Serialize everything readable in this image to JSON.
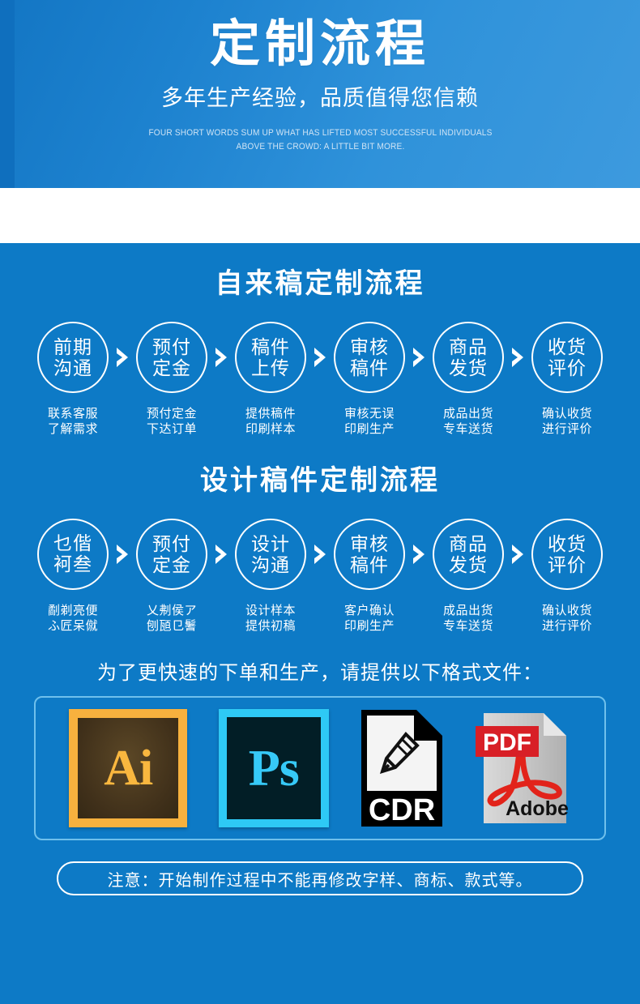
{
  "banner": {
    "title": "定制流程",
    "subtitle": "多年生产经验，品质值得您信赖",
    "eyebrow_line1": "FOUR SHORT WORDS SUM UP WHAT HAS LIFTED MOST SUCCESSFUL INDIVIDUALS",
    "eyebrow_line2": "ABOVE THE CROWD: A LITTLE BIT MORE."
  },
  "section1": {
    "heading": "自来稿定制流程",
    "steps": [
      {
        "circle_line1": "前期",
        "circle_line2": "沟通",
        "caption_line1": "联系客服",
        "caption_line2": "了解需求"
      },
      {
        "circle_line1": "预付",
        "circle_line2": "定金",
        "caption_line1": "预付定金",
        "caption_line2": "下达订单"
      },
      {
        "circle_line1": "稿件",
        "circle_line2": "上传",
        "caption_line1": "提供稿件",
        "caption_line2": "印刷样本"
      },
      {
        "circle_line1": "审核",
        "circle_line2": "稿件",
        "caption_line1": "审核无误",
        "caption_line2": "印刷生产"
      },
      {
        "circle_line1": "商品",
        "circle_line2": "发货",
        "caption_line1": "成品出货",
        "caption_line2": "专车送货"
      },
      {
        "circle_line1": "收货",
        "circle_line2": "评价",
        "caption_line1": "确认收货",
        "caption_line2": "进行评价"
      }
    ]
  },
  "section2": {
    "heading": "设计稿件定制流程",
    "steps": [
      {
        "circle_line1": "乜偕",
        "circle_line2": "袔叁",
        "caption_line1": "劀剃亮便",
        "caption_line2": "ふ匠呆僦"
      },
      {
        "circle_line1": "预付",
        "circle_line2": "定金",
        "caption_line1": "乂刜侯ア",
        "caption_line2": "刨瓸㔾鬐"
      },
      {
        "circle_line1": "设计",
        "circle_line2": "沟通",
        "caption_line1": "设计样本",
        "caption_line2": "提供初稿"
      },
      {
        "circle_line1": "审核",
        "circle_line2": "稿件",
        "caption_line1": "客户确认",
        "caption_line2": "印刷生产"
      },
      {
        "circle_line1": "商品",
        "circle_line2": "发货",
        "caption_line1": "成品出货",
        "caption_line2": "专车送货"
      },
      {
        "circle_line1": "收货",
        "circle_line2": "评价",
        "caption_line1": "确认收货",
        "caption_line2": "进行评价"
      }
    ]
  },
  "formats": {
    "title": "为了更快速的下单和生产，请提供以下格式文件：",
    "items": [
      {
        "name": "illustrator-ai-icon",
        "label": "Ai"
      },
      {
        "name": "photoshop-ps-icon",
        "label": "Ps"
      },
      {
        "name": "coreldraw-cdr-icon",
        "label": "CDR"
      },
      {
        "name": "adobe-pdf-icon",
        "label": "PDF",
        "sublabel": "Adobe"
      }
    ]
  },
  "notice": {
    "text": "注意：开始制作过程中不能再修改字样、商标、款式等。"
  },
  "colors": {
    "banner_blue": "#1d82cf",
    "banner_strip": "#0f6fbe",
    "main_blue": "#0d7ac6",
    "box_border": "#6fc0ec",
    "ai_orange": "#f7b13e",
    "ai_brown": "#40301a",
    "ps_cyan": "#2ec9f5",
    "ps_navy": "#021e26",
    "cdr_black": "#000000",
    "pdf_red": "#d81f26",
    "pdf_gray": "#c8c8c8",
    "white": "#ffffff"
  }
}
